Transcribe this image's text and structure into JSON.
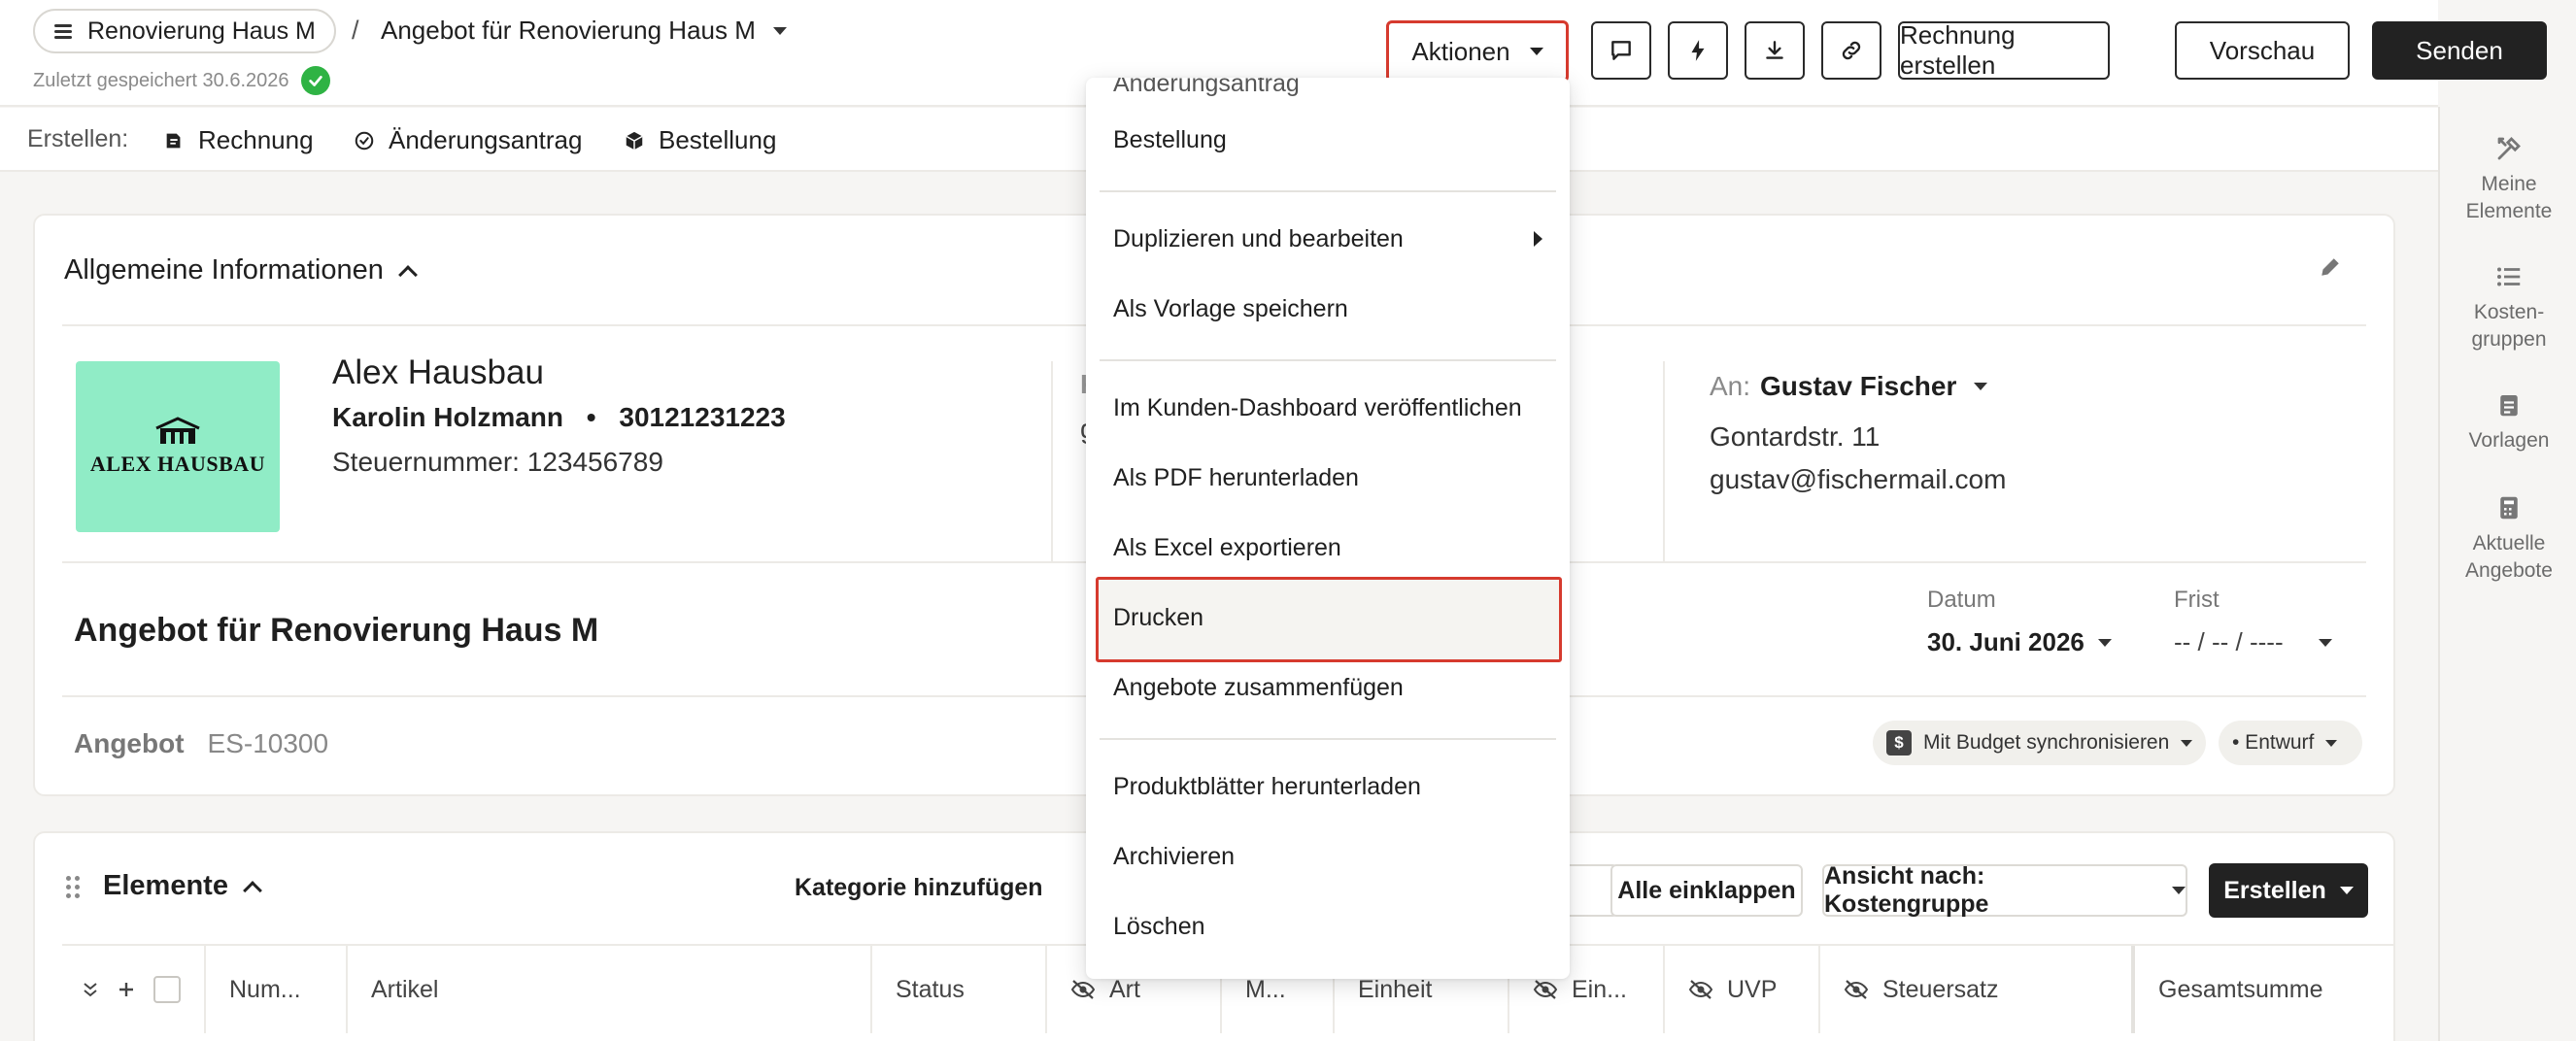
{
  "header": {
    "project": "Renovierung Haus M",
    "separator": "/",
    "title": "Angebot für Renovierung Haus M",
    "saved": "Zuletzt gespeichert 30.6.2026"
  },
  "toolbar": {
    "actions_label": "Aktionen",
    "invoice_label": "Rechnung erstellen",
    "preview_label": "Vorschau",
    "send_label": "Senden"
  },
  "createbar": {
    "label": "Erstellen:",
    "items": [
      "Rechnung",
      "Änderungsantrag",
      "Bestellung"
    ]
  },
  "sidebar": {
    "items": [
      {
        "label": "Meine\nElemente"
      },
      {
        "label": "Kosten-\ngruppen"
      },
      {
        "label": "Vorlagen"
      },
      {
        "label": "Aktuelle\nAngebote"
      }
    ]
  },
  "info": {
    "section_title": "Allgemeine Informationen",
    "logo_text": "ALEX HAUSBAU",
    "company": "Alex Hausbau",
    "contact": "Karolin Holzmann",
    "bullet": "•",
    "phone": "30121231223",
    "tax": "Steuernummer: 123456789",
    "partial_k": "K",
    "partial_g": "g",
    "to_label": "An:",
    "to_name": "Gustav Fischer",
    "address": "Gontardstr. 11",
    "email": "gustav@fischermail.com",
    "quote_title": "Angebot für Renovierung Haus M",
    "date_label": "Datum",
    "date_value": "30. Juni 2026",
    "deadline_label": "Frist",
    "deadline_value": "-- / -- / ----",
    "kind_label": "Angebot",
    "kind_value": "ES-10300",
    "budget_sync": "Mit Budget synchronisieren",
    "status": "• Entwurf"
  },
  "elements": {
    "title": "Elemente",
    "add_category": "Kategorie hinzufügen",
    "collapse_all": "Alle einklappen",
    "view_by": "Ansicht nach: Kostengruppe",
    "create": "Erstellen",
    "columns": [
      "Num...",
      "Artikel",
      "Status",
      "Art",
      "M...",
      "Einheit",
      "Ein...",
      "UVP",
      "Steuersatz",
      "Gesamtsumme"
    ]
  },
  "menu": {
    "items": [
      "Änderungsantrag",
      "Bestellung",
      "Duplizieren und bearbeiten",
      "Als Vorlage speichern",
      "Im Kunden-Dashboard veröffentlichen",
      "Als PDF herunterladen",
      "Als Excel exportieren",
      "Drucken",
      "Angebote zusammenfügen",
      "Produktblätter herunterladen",
      "Archivieren",
      "Löschen"
    ],
    "highlighted": "Drucken"
  },
  "colors": {
    "highlight_border": "#d63a2e",
    "logo_bg": "#90ecc6",
    "saved_check": "#2fb344",
    "dark_button": "#222222"
  },
  "icons": [
    "menu-icon",
    "check-icon",
    "comment-icon",
    "lightning-icon",
    "download-icon",
    "link-icon",
    "invoice-icon",
    "change-request-icon",
    "box-icon",
    "tools-icon",
    "list-icon",
    "clipboard-icon",
    "calculator-icon",
    "pencil-icon",
    "dollar-icon",
    "eye-off-icon",
    "drag-handle-icon",
    "chevron-up-icon"
  ]
}
